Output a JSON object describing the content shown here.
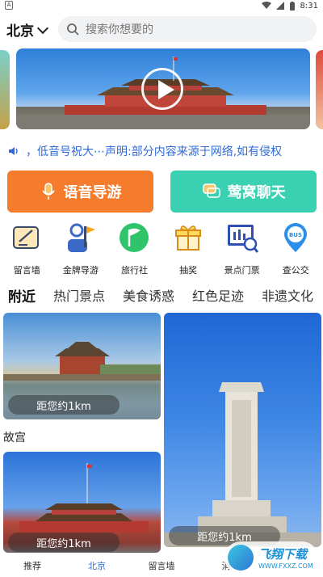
{
  "status_bar": {
    "time": "8:31",
    "left_icon": "A"
  },
  "header": {
    "city": "北京",
    "search_placeholder": "搜索你想要的"
  },
  "banner": {
    "play_icon": "play-icon"
  },
  "notice": {
    "text": "，低音号祝大⋯声明:部分内容来源于网络,如有侵权"
  },
  "big_buttons": {
    "audio_guide": "语音导游",
    "chat": "莺窝聊天"
  },
  "quick_links": [
    {
      "label": "留言墙",
      "icon": "message-board-icon"
    },
    {
      "label": "金牌导游",
      "icon": "guide-icon"
    },
    {
      "label": "旅行社",
      "icon": "flag-icon"
    },
    {
      "label": "抽奖",
      "icon": "gift-icon"
    },
    {
      "label": "景点门票",
      "icon": "ticket-icon"
    },
    {
      "label": "查公交",
      "icon": "bus-icon"
    }
  ],
  "category_tabs": [
    "附近",
    "热门景点",
    "美食诱惑",
    "红色足迹",
    "非遗文化"
  ],
  "feed": [
    {
      "distance": "距您约1km",
      "title": "故宫"
    },
    {
      "distance": "距您约1km"
    },
    {
      "distance": "距您约1km"
    }
  ],
  "bottom_tabs": [
    "推荐",
    "北京",
    "留言墙",
    "消"
  ],
  "watermark": {
    "name": "飞翔下载",
    "url": "WWW.FXXZ.COM"
  },
  "colors": {
    "accent_blue": "#2f6bd6",
    "audio_orange": "#f47c2c",
    "chat_teal": "#3ad0b2"
  }
}
